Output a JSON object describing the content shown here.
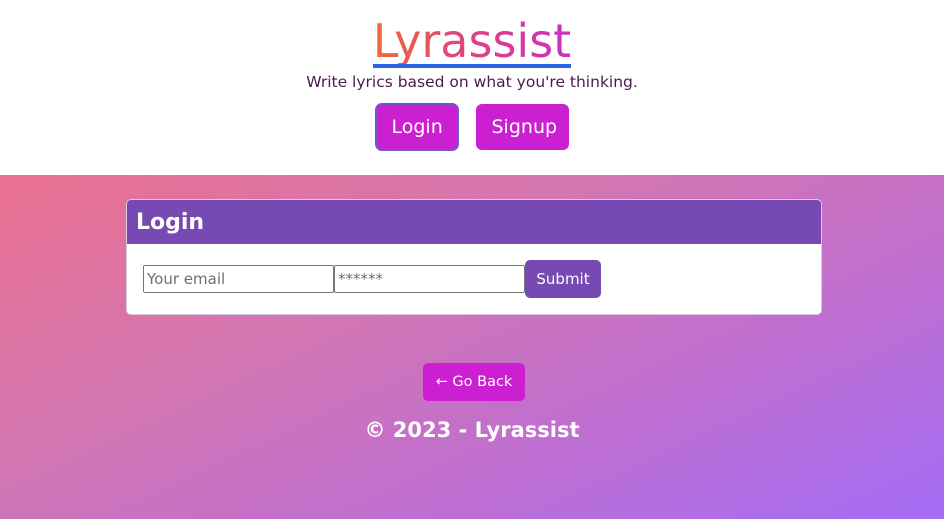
{
  "header": {
    "brand": "Lyrassist",
    "tagline": "Write lyrics based on what you're thinking.",
    "nav": {
      "login_label": "Login",
      "signup_label": "Signup"
    }
  },
  "login_card": {
    "title": "Login",
    "email_placeholder": "Your email",
    "password_placeholder": "******",
    "submit_label": "Submit"
  },
  "back_button": {
    "label": "← Go Back"
  },
  "footer": {
    "text": "© 2023 - Lyrassist"
  },
  "colors": {
    "accent": "#cd1fd2",
    "card_header": "#7749b3",
    "brand_underline": "#2b63e6"
  }
}
